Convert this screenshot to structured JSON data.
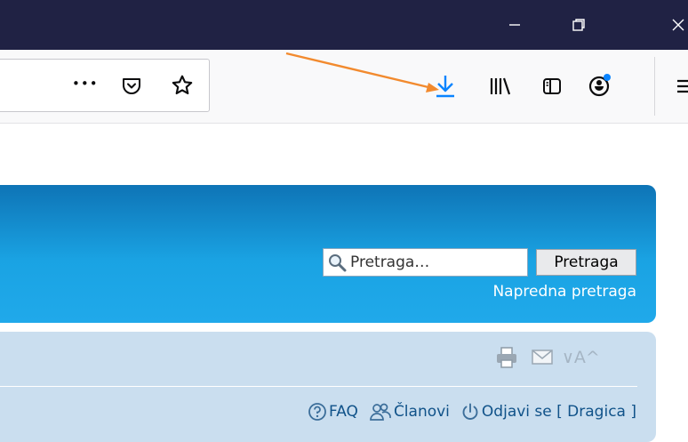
{
  "window": {
    "minimize_glyph": "—",
    "restore_glyph": "❐",
    "close_glyph": "✕"
  },
  "toolbar": {
    "page_actions_glyph": "•••",
    "icons": [
      "pocket-icon",
      "bookmark-star-icon",
      "download-icon",
      "library-icon",
      "sidebar-icon",
      "account-icon",
      "menu-icon"
    ],
    "download_color": "#0a84ff",
    "annotation_arrow_color": "#f28a2e"
  },
  "header": {
    "search_placeholder": "Pretraga…",
    "search_button": "Pretraga",
    "advanced_search": "Napredna pretraga"
  },
  "nav": {
    "tools": {
      "font_change": "∨A^"
    },
    "links": {
      "faq": "FAQ",
      "members": "Članovi",
      "logout": "Odjavi se [ Dragica ]"
    }
  }
}
